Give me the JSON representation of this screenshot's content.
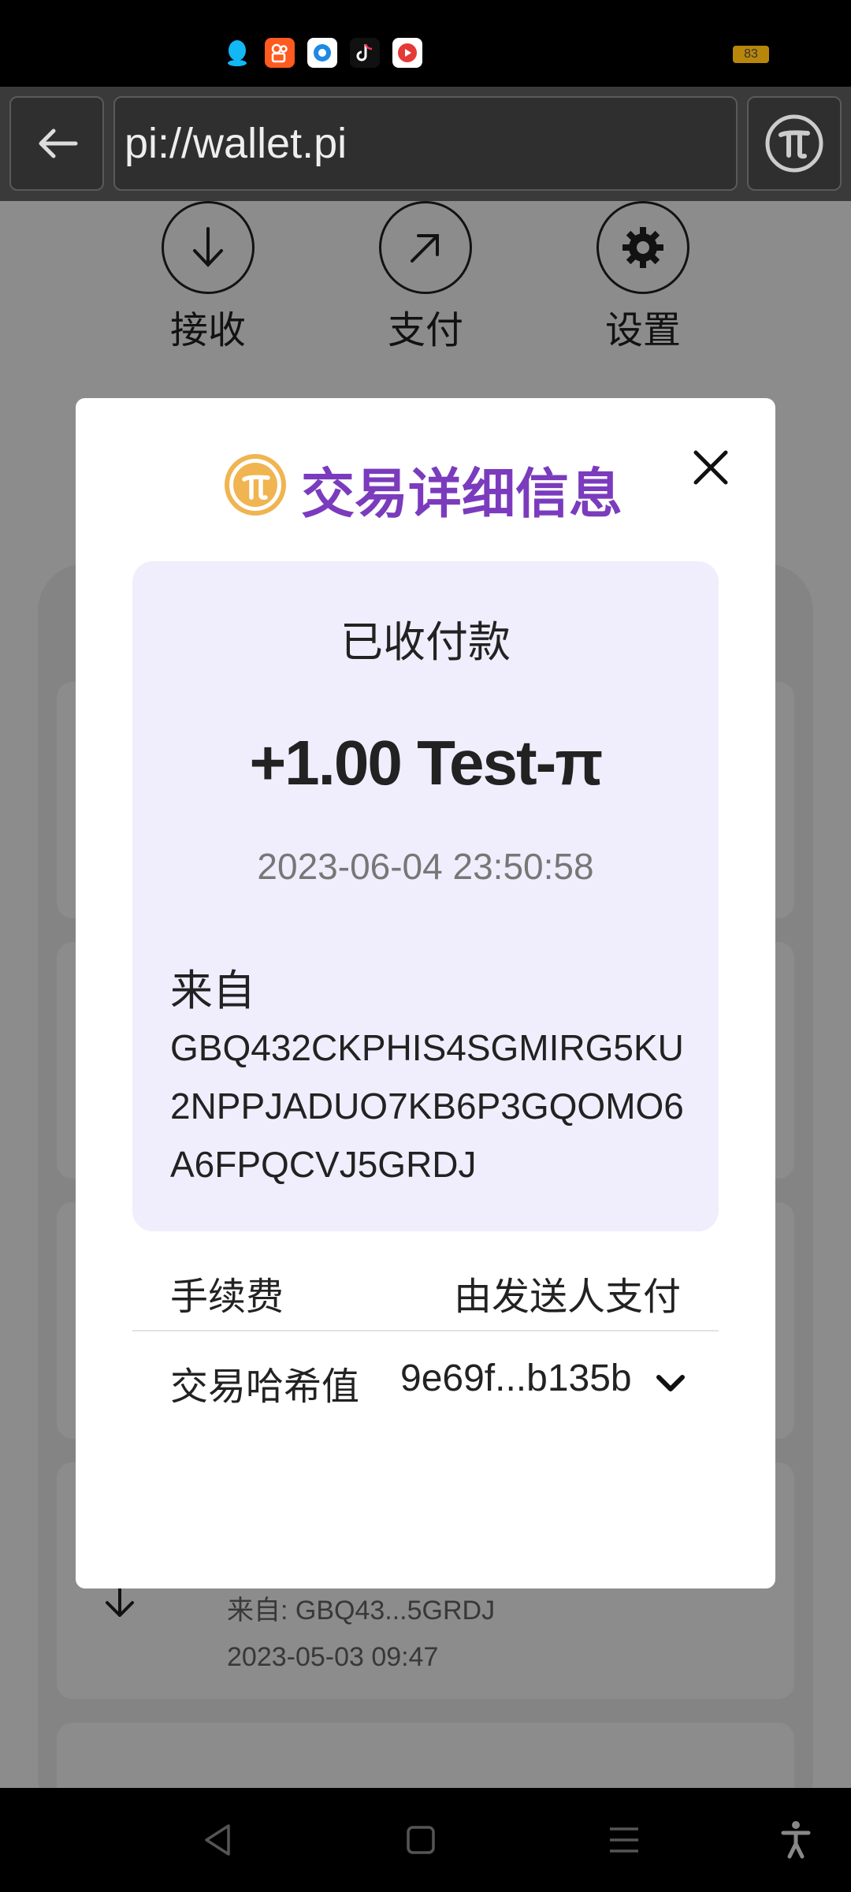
{
  "status_bar": {
    "app_icons": [
      "qq-icon",
      "kuaishou-icon",
      "browser-icon",
      "tiktok-icon",
      "video-icon"
    ],
    "battery": "83"
  },
  "browser": {
    "url": "pi://wallet.pi"
  },
  "actions": [
    {
      "label": "接收",
      "icon": "arrow-down-icon"
    },
    {
      "label": "支付",
      "icon": "arrow-up-right-icon"
    },
    {
      "label": "设置",
      "icon": "gear-icon"
    }
  ],
  "background_tx": {
    "from": "来自: GBQ43...5GRDJ",
    "date": "2023-05-03 09:47"
  },
  "modal": {
    "title": "交易详细信息",
    "status": "已收付款",
    "amount": "+1.00 Test-π",
    "time": "2023-06-04 23:50:58",
    "from_label": "来自",
    "from_address": "GBQ432CKPHIS4SGMIRG5KU2NPPJADUO7KB6P3GQOMO6A6FPQCVJ5GRDJ",
    "fee_label": "手续费",
    "fee_value": "由发送人支付",
    "hash_label": "交易哈希值",
    "hash_value": "9e69f...b135b"
  },
  "colors": {
    "title_purple": "#7b3bbd",
    "pi_gold": "#f0b450",
    "card_lavender": "#f0eefc"
  }
}
